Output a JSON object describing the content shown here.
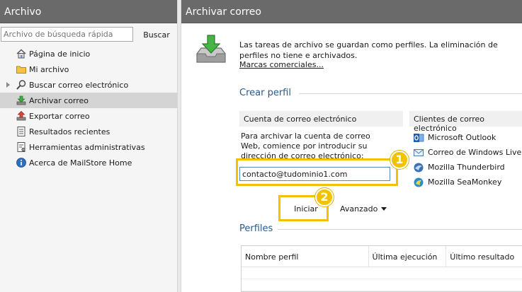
{
  "left_pane": {
    "title": "Archivo",
    "search": {
      "placeholder": "Archivo de búsqueda rápida",
      "button_label": "Buscar"
    },
    "nav_items": [
      {
        "label": "Página de inicio",
        "icon": "home-icon"
      },
      {
        "label": "Mi archivo",
        "icon": "folder-icon"
      },
      {
        "label": "Buscar correo electrónico",
        "icon": "magnifier-icon"
      },
      {
        "label": "Archivar correo",
        "icon": "archive-down-icon",
        "selected": true
      },
      {
        "label": "Exportar correo",
        "icon": "export-icon"
      },
      {
        "label": "Resultados recientes",
        "icon": "document-list-icon"
      },
      {
        "label": "Herramientas administrativas",
        "icon": "tools-document-icon"
      },
      {
        "label": "Acerca de MailStore Home",
        "icon": "info-icon"
      }
    ]
  },
  "right_pane": {
    "title": "Archivar correo",
    "intro_text": "Las tareas de archivo se guardan como perfiles. La eliminación de perfiles no tiene e archivados.",
    "trademark_link": "Marcas comerciales...",
    "create_profile": {
      "title": "Crear perfil",
      "email_account": {
        "header": "Cuenta de correo electrónico",
        "description": "Para archivar la cuenta de correo Web, comience por introducir su dirección de correo electrónico:",
        "email_value": "contacto@tudominio1.com"
      },
      "email_clients": {
        "header": "Clientes de correo electrónico",
        "items": [
          {
            "label": "Microsoft Outlook",
            "icon": "outlook-icon"
          },
          {
            "label": "Correo de Windows Live",
            "icon": "windows-live-mail-icon"
          },
          {
            "label": "Mozilla Thunderbird",
            "icon": "thunderbird-icon"
          },
          {
            "label": "Mozilla SeaMonkey",
            "icon": "seamonkey-icon"
          }
        ]
      },
      "start_button": "Iniciar",
      "advanced_button": "Avanzado"
    },
    "profiles": {
      "title": "Perfiles",
      "columns": [
        "Nombre perfil",
        "Última ejecución",
        "Último resultado"
      ]
    }
  },
  "annotations": {
    "badge_1": "1",
    "badge_2": "2",
    "highlight_color": "#f2c200"
  },
  "colors": {
    "header_bg": "#6a6a6a",
    "selected_bg": "#d4d4d4",
    "section_title": "#2a5a8a"
  }
}
